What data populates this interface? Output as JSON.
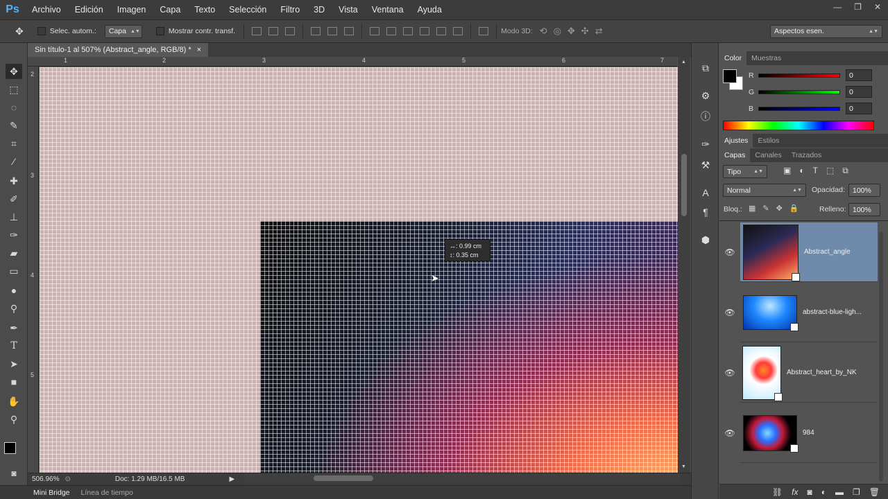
{
  "app": {
    "logo": "Ps"
  },
  "menu": [
    "Archivo",
    "Edición",
    "Imagen",
    "Capa",
    "Texto",
    "Selección",
    "Filtro",
    "3D",
    "Vista",
    "Ventana",
    "Ayuda"
  ],
  "window_controls": [
    "—",
    "❐",
    "✕"
  ],
  "options": {
    "auto_select_label": "Selec. autom.:",
    "auto_select_value": "Capa",
    "show_transform_label": "Mostrar contr. transf.",
    "mode3d_label": "Modo 3D:",
    "workspace": "Aspectos esen."
  },
  "document_tab": {
    "title": "Sin título-1 al 507% (Abstract_angle, RGB/8) *",
    "close": "×"
  },
  "ruler": {
    "top": [
      "1",
      "2",
      "3",
      "4",
      "5",
      "6",
      "7"
    ],
    "left": [
      "2",
      "3",
      "4",
      "5"
    ]
  },
  "tooltip": {
    "line1": "↔: 0.99 cm",
    "line2": "↕: 0.35 cm"
  },
  "status": {
    "zoom": "506.96%",
    "doc": "Doc: 1.29 MB/16.5 MB"
  },
  "bottom_tabs": [
    "Mini Bridge",
    "Línea de tiempo"
  ],
  "color_panel": {
    "tabs": [
      "Color",
      "Muestras"
    ],
    "r_label": "R",
    "g_label": "G",
    "b_label": "B",
    "r": "0",
    "g": "0",
    "b": "0"
  },
  "adjust_tabs": [
    "Ajustes",
    "Estilos"
  ],
  "layers_panel": {
    "tabs": [
      "Capas",
      "Canales",
      "Trazados"
    ],
    "filter": "Tipo",
    "blend_mode": "Normal",
    "opacity_label": "Opacidad:",
    "opacity": "100%",
    "lock_label": "Bloq.:",
    "fill_label": "Relleno:",
    "fill": "100%",
    "layers": [
      {
        "name": "Abstract_angle"
      },
      {
        "name": "abstract-blue-ligh..."
      },
      {
        "name": "Abstract_heart_by_NKeo"
      },
      {
        "name": "984"
      }
    ]
  },
  "colors": {
    "accent": "#4fb4ff",
    "selected_layer": "#6f8aaa",
    "panel_bg": "#535353"
  }
}
